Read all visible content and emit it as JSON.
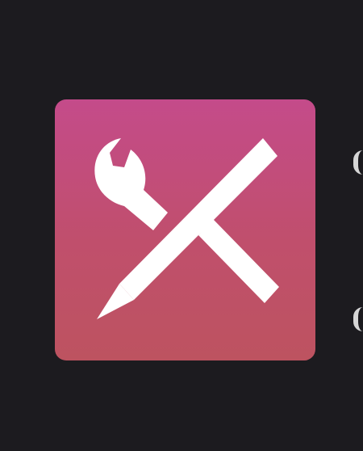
{
  "app_icon": {
    "icon": "wrench-pencil-icon",
    "colors": {
      "gradient_top": "#c44b8a",
      "gradient_bottom": "#bd5360",
      "glyph": "#ffffff",
      "background": "#1c1b1f"
    }
  },
  "edge_fragments": {
    "icon": "partial-glyph",
    "color": "#d6d6d6"
  }
}
